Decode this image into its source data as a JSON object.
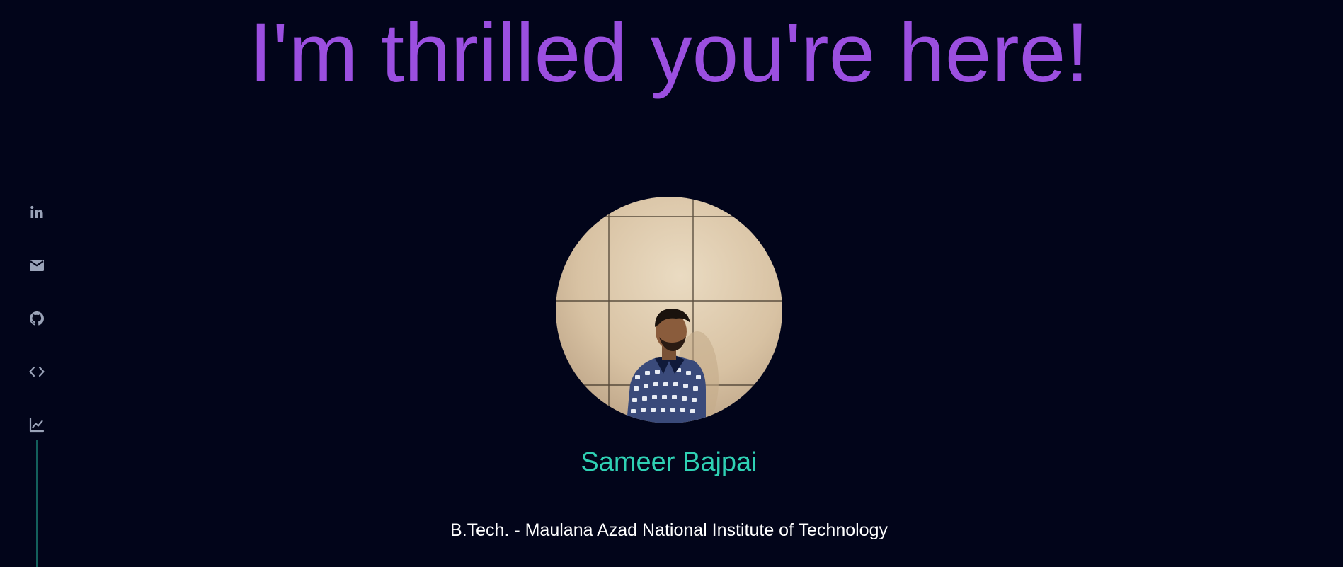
{
  "hero": {
    "title": "I'm thrilled you're here!"
  },
  "social_links": [
    {
      "icon": "linkedin-icon",
      "label": "in"
    },
    {
      "icon": "mail-icon"
    },
    {
      "icon": "github-icon"
    },
    {
      "icon": "code-icon"
    },
    {
      "icon": "chart-icon"
    }
  ],
  "profile": {
    "name": "Sameer Bajpai",
    "education": "B.Tech. - Maulana Azad National Institute of Technology"
  },
  "colors": {
    "background": "#02051a",
    "title": "#9b4fe0",
    "name": "#2fd1b4",
    "icon": "#9aa3b8",
    "rail": "#14605c"
  }
}
